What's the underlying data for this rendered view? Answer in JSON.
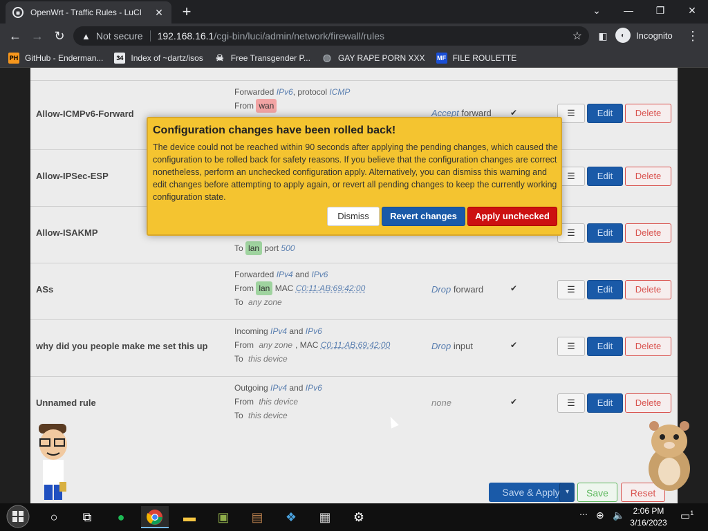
{
  "browser": {
    "tab_title": "OpenWrt - Traffic Rules - LuCI",
    "address_warning": "Not secure",
    "url_host": "192.168.16.1",
    "url_path": "/cgi-bin/luci/admin/network/firewall/rules",
    "profile_label": "Incognito",
    "bookmarks": [
      {
        "label": "GitHub - Enderman...",
        "icon_text": "PH",
        "icon_color": "#f7971d"
      },
      {
        "label": "Index of ~dartz/isos",
        "icon_text": "34",
        "icon_color": "#e8eaed"
      },
      {
        "label": "Free Transgender P...",
        "icon_text": "",
        "icon_color": "#e8eaed"
      },
      {
        "label": "GAY RAPE PORN XXX",
        "icon_text": "",
        "icon_color": "#9aa0a6"
      },
      {
        "label": "FILE ROULETTE",
        "icon_text": "MF",
        "icon_color": "#1a4fd6"
      }
    ]
  },
  "rules": [
    {
      "name": "Allow-ICMPv6-Forward",
      "lines": [
        "Forwarded",
        "IPv6",
        ", protocol",
        "ICMP"
      ],
      "from_label": "From",
      "from_zone": "wan",
      "action_verb": "Accept",
      "action_target": "forward"
    },
    {
      "name": "Allow-IPSec-ESP"
    },
    {
      "name": "Allow-ISAKMP",
      "to_label": "To",
      "to_zone": "lan",
      "to_port_label": "port",
      "to_port": "500"
    },
    {
      "name": "ASs",
      "line1": "Forwarded",
      "proto_a": "IPv4",
      "and": "and",
      "proto_b": "IPv6",
      "from_label": "From",
      "from_zone": "lan",
      "mac_label": "MAC",
      "mac": "C0:11:AB:69:42:00",
      "to_label": "To",
      "to_zone": "any zone",
      "action_verb": "Drop",
      "action_target": "forward"
    },
    {
      "name": "why did you people make me set this up",
      "line1": "Incoming",
      "proto_a": "IPv4",
      "and": "and",
      "proto_b": "IPv6",
      "from_label": "From",
      "from_zone": "any zone",
      "mac_label": ", MAC",
      "mac": "C0:11:AB:69:42:00",
      "to_label": "To",
      "to_zone": "this device",
      "action_verb": "Drop",
      "action_target": "input"
    },
    {
      "name": "Unnamed rule",
      "line1": "Outgoing",
      "proto_a": "IPv4",
      "and": "and",
      "proto_b": "IPv6",
      "from_label": "From",
      "from_zone": "this device",
      "to_label": "To",
      "to_zone": "this device",
      "action_text": "none"
    }
  ],
  "row_buttons": {
    "menu": "☰",
    "edit": "Edit",
    "delete": "Delete",
    "check": "✔"
  },
  "modal": {
    "title": "Configuration changes have been rolled back!",
    "body": "The device could not be reached within 90 seconds after applying the pending changes, which caused the configuration to be rolled back for safety reasons. If you believe that the configuration changes are correct nonetheless, perform an unchecked configuration apply. Alternatively, you can dismiss this warning and edit changes before attempting to apply again, or revert all pending changes to keep the currently working configuration state.",
    "dismiss": "Dismiss",
    "revert": "Revert changes",
    "apply": "Apply unchecked"
  },
  "footer": {
    "save_apply": "Save & Apply",
    "save": "Save",
    "reset": "Reset"
  },
  "taskbar": {
    "time": "2:06 PM",
    "date": "3/16/2023",
    "notification_count": "1"
  },
  "colors": {
    "accent_blue": "#1a5aa8",
    "danger_red": "#cc1111",
    "modal_yellow": "#f4c430"
  }
}
